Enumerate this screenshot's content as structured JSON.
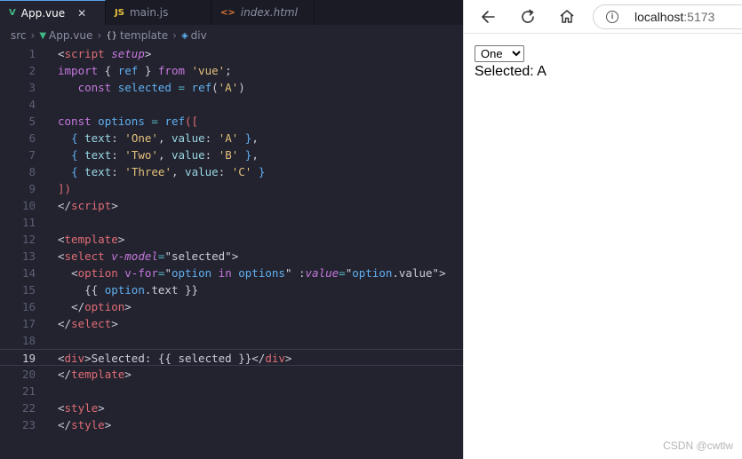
{
  "editor": {
    "tabs": [
      {
        "label": "App.vue",
        "icon": "V",
        "close": "✕"
      },
      {
        "label": "main.js",
        "icon": "JS"
      },
      {
        "label": "index.html",
        "icon": "<>"
      }
    ],
    "breadcrumb": [
      "src",
      "App.vue",
      "template",
      "div"
    ],
    "current_line": 19
  },
  "browser": {
    "url_host": "localhost",
    "url_port": ":5173",
    "select_value": "One",
    "select_options": [
      "One",
      "Two",
      "Three"
    ],
    "selected_label": "Selected:",
    "selected_value": "A"
  },
  "watermark": "CSDN @cwtlw",
  "colors": {
    "accent": "#5aa0e6",
    "vue_green": "#41b883",
    "js_yellow": "#e8c23d",
    "html_orange": "#e37933"
  }
}
